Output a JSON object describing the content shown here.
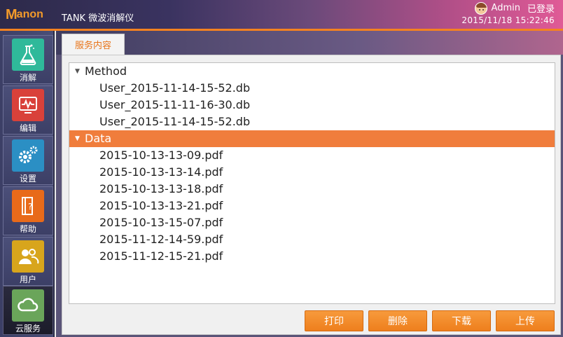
{
  "header": {
    "logo_m": "M",
    "logo_rest": "anon",
    "app_title": "TANK 微波消解仪",
    "user_name": "Admin",
    "login_status": "已登录",
    "datetime": "2015/11/18 15:22:46",
    "colors": {
      "accent": "#f58220",
      "brand": "#f39a2a"
    }
  },
  "sidebar": {
    "items": [
      {
        "label": "消解",
        "icon": "flask-icon",
        "color": "#2fb99a"
      },
      {
        "label": "编辑",
        "icon": "monitor-chart-icon",
        "color": "#d9413a"
      },
      {
        "label": "设置",
        "icon": "gears-icon",
        "color": "#2b8fc4"
      },
      {
        "label": "帮助",
        "icon": "help-book-icon",
        "color": "#e86a1a"
      },
      {
        "label": "用户",
        "icon": "users-icon",
        "color": "#d8a51c"
      },
      {
        "label": "云服务",
        "icon": "cloud-icon",
        "color": "#6aa55a"
      }
    ],
    "active_index": 5
  },
  "main": {
    "tab_label": "服务内容",
    "tree": [
      {
        "label": "Method",
        "expanded": true,
        "selected": false,
        "children": [
          "User_2015-11-14-15-52.db",
          "User_2015-11-11-16-30.db",
          "User_2015-11-14-15-52.db"
        ]
      },
      {
        "label": "Data",
        "expanded": true,
        "selected": true,
        "children": [
          "2015-10-13-13-09.pdf",
          "2015-10-13-13-14.pdf",
          "2015-10-13-13-18.pdf",
          "2015-10-13-13-21.pdf",
          "2015-10-13-15-07.pdf",
          "2015-11-12-14-59.pdf",
          "2015-11-12-15-21.pdf"
        ]
      }
    ],
    "buttons": {
      "print": "打印",
      "delete": "删除",
      "download": "下载",
      "upload": "上传"
    }
  }
}
